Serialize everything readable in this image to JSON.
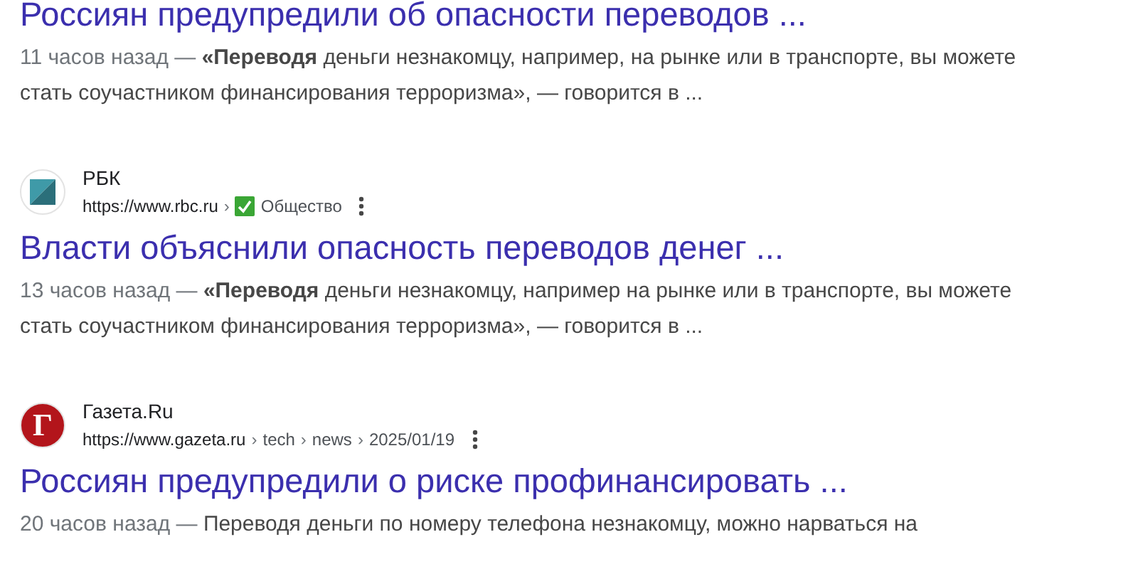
{
  "results": [
    {
      "title": "Россиян предупредили об опасности переводов ...",
      "date": "11 часов назад —",
      "snippet": "**«Переводя** деньги незнакомцу, например, на рынке или в транспорте, вы можете стать соучастником финансирования терроризма», — говорится в ..."
    },
    {
      "source": {
        "name": "РБК",
        "kind": "rbc",
        "url": "https://www.rbc.ru",
        "separator": "›",
        "path": [
          {
            "label": "Общество",
            "checked": true
          }
        ]
      },
      "title": "Власти объяснили опасность переводов денег ...",
      "date": "13 часов назад —",
      "snippet": "**«Переводя** деньги незнакомцу, например на рынке или в транспорте, вы можете стать соучастником финансирования терроризма», — говорится в ..."
    },
    {
      "source": {
        "name": "Газета.Ru",
        "kind": "gazeta",
        "logo_letter": "Г",
        "url": "https://www.gazeta.ru",
        "separator": "›",
        "path": [
          {
            "label": "tech",
            "checked": false
          },
          {
            "label": "news",
            "checked": false
          },
          {
            "label": "2025/01/19",
            "checked": false
          }
        ]
      },
      "title": "Россиян предупредили о риске профинансировать ...",
      "date": "20 часов назад —",
      "snippet": "Переводя деньги по номеру телефона незнакомцу, можно нарваться на"
    }
  ]
}
